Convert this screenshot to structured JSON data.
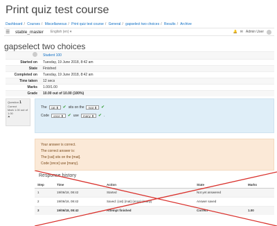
{
  "course_title": "Print quiz test course",
  "breadcrumb": [
    "Dashboard",
    "Courses",
    "Miscellaneous",
    "Print quiz test course",
    "General",
    "gapselect two choices",
    "Results",
    "Archive"
  ],
  "navbar": {
    "site_name": "stable_master",
    "language": "English (en) ▾",
    "user_name": "Admin User",
    "menu_icon": "hamburger-icon"
  },
  "quiz_title": "gapselect two choices",
  "summary": {
    "user": "Student 100",
    "rows": [
      {
        "k": "Started on",
        "v": "Tuesday, 19 June 2018, 8:42 am"
      },
      {
        "k": "State",
        "v": "Finished"
      },
      {
        "k": "Completed on",
        "v": "Tuesday, 19 June 2018, 8:42 am"
      },
      {
        "k": "Time taken",
        "v": "12 secs"
      },
      {
        "k": "Marks",
        "v": "1.00/1.00"
      },
      {
        "k": "Grade",
        "v": "10.00 out of 10.00 (100%)"
      }
    ]
  },
  "question_info": {
    "label": "Question",
    "number": "1",
    "state": "Correct",
    "mark": "Mark 1.00 out of 1.00"
  },
  "question": {
    "line1_pre": "The",
    "line1_sel1": "cat ⬍",
    "line1_mid": "sits on the",
    "line1_sel2": "mat ⬍",
    "line2_pre": "Code",
    "line2_sel1": "once ⬍",
    "line2_mid": "use",
    "line2_sel2": "many ⬍"
  },
  "feedback": {
    "line1": "Your answer is correct.",
    "line2": "The correct answer is:",
    "line3": "The [cat] sits on the [mat].",
    "line4": "Code [once] use [many]."
  },
  "response_history": {
    "title": "Response history",
    "headers": [
      "Step",
      "Time",
      "Action",
      "State",
      "Marks"
    ],
    "rows": [
      [
        "1",
        "19/06/18, 08:42",
        "Started",
        "Not yet answered",
        ""
      ],
      [
        "2",
        "19/06/18, 08:42",
        "Saved: {cat} {mat} {once} {many}",
        "Answer saved",
        ""
      ],
      [
        "3",
        "19/06/18, 08:42",
        "Attempt finished",
        "Correct",
        "1.00"
      ]
    ]
  },
  "colors": {
    "link": "#0f6fc5",
    "cross": "#d9302b",
    "info_bg": "#dfeef8",
    "feedback_bg": "#fbe9d7"
  }
}
